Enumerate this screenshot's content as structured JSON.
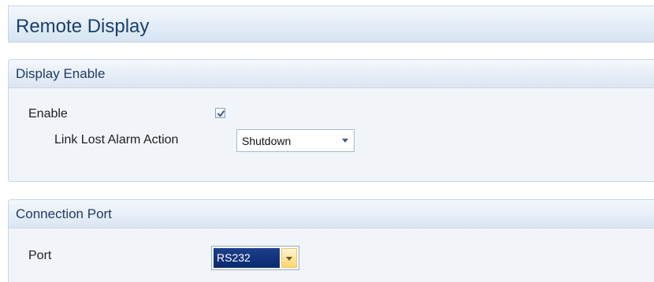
{
  "page": {
    "title": "Remote Display"
  },
  "display_enable": {
    "title": "Display Enable",
    "enable_label": "Enable",
    "enable_checked": true,
    "link_lost_label": "Link Lost Alarm Action",
    "link_lost_value": "Shutdown"
  },
  "connection_port": {
    "title": "Connection Port",
    "port_label": "Port",
    "port_value": "RS232"
  },
  "icons": {
    "checkbox_check": "check-mark-icon",
    "dropdown_arrow": "chevron-down-icon"
  },
  "colors": {
    "title_text": "#1b3f6d",
    "selection_bg": "#0a2a6e",
    "dropdown_button_highlight": "#ffd56a"
  }
}
